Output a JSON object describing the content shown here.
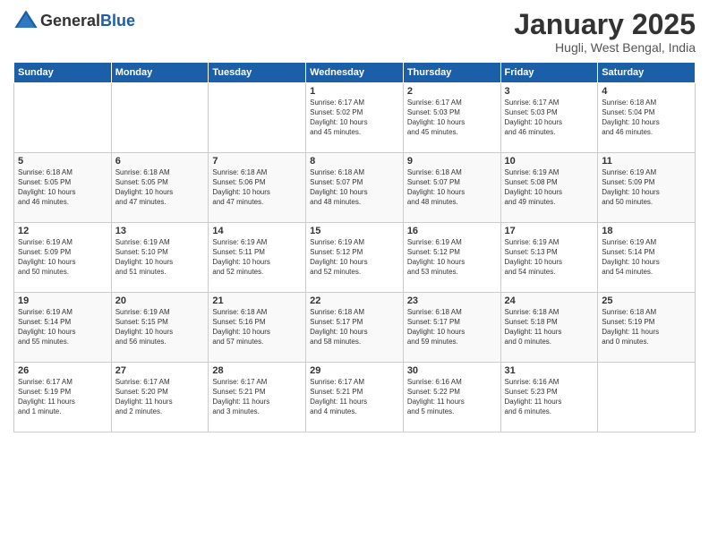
{
  "header": {
    "logo_line1": "General",
    "logo_line2": "Blue",
    "title": "January 2025",
    "subtitle": "Hugli, West Bengal, India"
  },
  "days_of_week": [
    "Sunday",
    "Monday",
    "Tuesday",
    "Wednesday",
    "Thursday",
    "Friday",
    "Saturday"
  ],
  "weeks": [
    [
      {
        "day": "",
        "info": ""
      },
      {
        "day": "",
        "info": ""
      },
      {
        "day": "",
        "info": ""
      },
      {
        "day": "1",
        "info": "Sunrise: 6:17 AM\nSunset: 5:02 PM\nDaylight: 10 hours\nand 45 minutes."
      },
      {
        "day": "2",
        "info": "Sunrise: 6:17 AM\nSunset: 5:03 PM\nDaylight: 10 hours\nand 45 minutes."
      },
      {
        "day": "3",
        "info": "Sunrise: 6:17 AM\nSunset: 5:03 PM\nDaylight: 10 hours\nand 46 minutes."
      },
      {
        "day": "4",
        "info": "Sunrise: 6:18 AM\nSunset: 5:04 PM\nDaylight: 10 hours\nand 46 minutes."
      }
    ],
    [
      {
        "day": "5",
        "info": "Sunrise: 6:18 AM\nSunset: 5:05 PM\nDaylight: 10 hours\nand 46 minutes."
      },
      {
        "day": "6",
        "info": "Sunrise: 6:18 AM\nSunset: 5:05 PM\nDaylight: 10 hours\nand 47 minutes."
      },
      {
        "day": "7",
        "info": "Sunrise: 6:18 AM\nSunset: 5:06 PM\nDaylight: 10 hours\nand 47 minutes."
      },
      {
        "day": "8",
        "info": "Sunrise: 6:18 AM\nSunset: 5:07 PM\nDaylight: 10 hours\nand 48 minutes."
      },
      {
        "day": "9",
        "info": "Sunrise: 6:18 AM\nSunset: 5:07 PM\nDaylight: 10 hours\nand 48 minutes."
      },
      {
        "day": "10",
        "info": "Sunrise: 6:19 AM\nSunset: 5:08 PM\nDaylight: 10 hours\nand 49 minutes."
      },
      {
        "day": "11",
        "info": "Sunrise: 6:19 AM\nSunset: 5:09 PM\nDaylight: 10 hours\nand 50 minutes."
      }
    ],
    [
      {
        "day": "12",
        "info": "Sunrise: 6:19 AM\nSunset: 5:09 PM\nDaylight: 10 hours\nand 50 minutes."
      },
      {
        "day": "13",
        "info": "Sunrise: 6:19 AM\nSunset: 5:10 PM\nDaylight: 10 hours\nand 51 minutes."
      },
      {
        "day": "14",
        "info": "Sunrise: 6:19 AM\nSunset: 5:11 PM\nDaylight: 10 hours\nand 52 minutes."
      },
      {
        "day": "15",
        "info": "Sunrise: 6:19 AM\nSunset: 5:12 PM\nDaylight: 10 hours\nand 52 minutes."
      },
      {
        "day": "16",
        "info": "Sunrise: 6:19 AM\nSunset: 5:12 PM\nDaylight: 10 hours\nand 53 minutes."
      },
      {
        "day": "17",
        "info": "Sunrise: 6:19 AM\nSunset: 5:13 PM\nDaylight: 10 hours\nand 54 minutes."
      },
      {
        "day": "18",
        "info": "Sunrise: 6:19 AM\nSunset: 5:14 PM\nDaylight: 10 hours\nand 54 minutes."
      }
    ],
    [
      {
        "day": "19",
        "info": "Sunrise: 6:19 AM\nSunset: 5:14 PM\nDaylight: 10 hours\nand 55 minutes."
      },
      {
        "day": "20",
        "info": "Sunrise: 6:19 AM\nSunset: 5:15 PM\nDaylight: 10 hours\nand 56 minutes."
      },
      {
        "day": "21",
        "info": "Sunrise: 6:18 AM\nSunset: 5:16 PM\nDaylight: 10 hours\nand 57 minutes."
      },
      {
        "day": "22",
        "info": "Sunrise: 6:18 AM\nSunset: 5:17 PM\nDaylight: 10 hours\nand 58 minutes."
      },
      {
        "day": "23",
        "info": "Sunrise: 6:18 AM\nSunset: 5:17 PM\nDaylight: 10 hours\nand 59 minutes."
      },
      {
        "day": "24",
        "info": "Sunrise: 6:18 AM\nSunset: 5:18 PM\nDaylight: 11 hours\nand 0 minutes."
      },
      {
        "day": "25",
        "info": "Sunrise: 6:18 AM\nSunset: 5:19 PM\nDaylight: 11 hours\nand 0 minutes."
      }
    ],
    [
      {
        "day": "26",
        "info": "Sunrise: 6:17 AM\nSunset: 5:19 PM\nDaylight: 11 hours\nand 1 minute."
      },
      {
        "day": "27",
        "info": "Sunrise: 6:17 AM\nSunset: 5:20 PM\nDaylight: 11 hours\nand 2 minutes."
      },
      {
        "day": "28",
        "info": "Sunrise: 6:17 AM\nSunset: 5:21 PM\nDaylight: 11 hours\nand 3 minutes."
      },
      {
        "day": "29",
        "info": "Sunrise: 6:17 AM\nSunset: 5:21 PM\nDaylight: 11 hours\nand 4 minutes."
      },
      {
        "day": "30",
        "info": "Sunrise: 6:16 AM\nSunset: 5:22 PM\nDaylight: 11 hours\nand 5 minutes."
      },
      {
        "day": "31",
        "info": "Sunrise: 6:16 AM\nSunset: 5:23 PM\nDaylight: 11 hours\nand 6 minutes."
      },
      {
        "day": "",
        "info": ""
      }
    ]
  ]
}
